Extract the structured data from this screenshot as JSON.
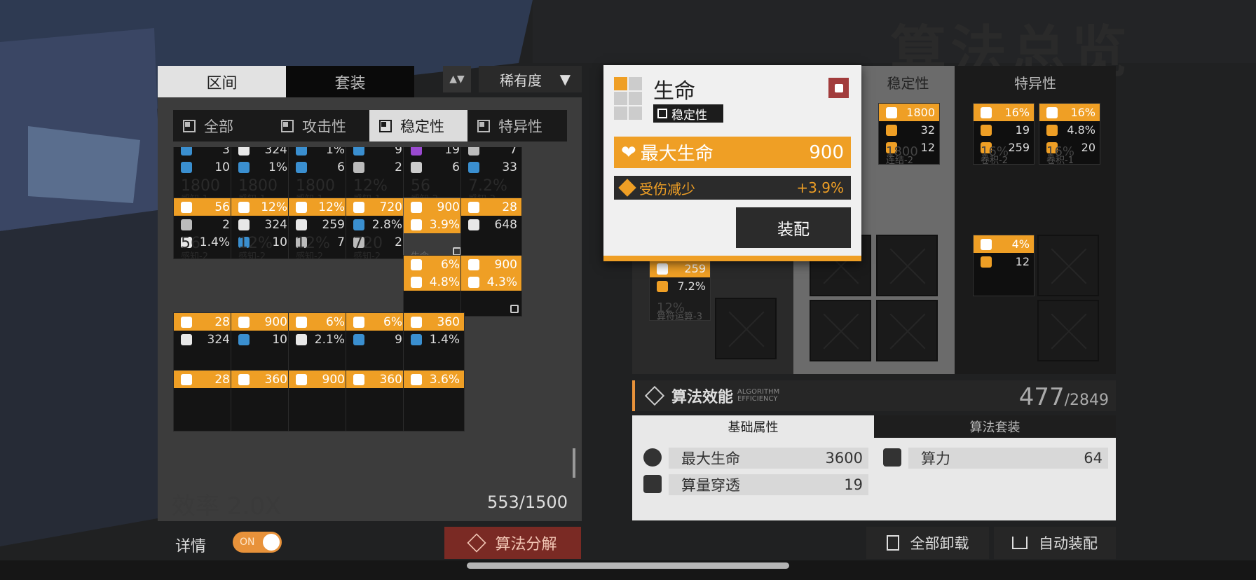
{
  "header": {
    "watermark": "算法总览"
  },
  "left": {
    "tabs": [
      {
        "label": "区间",
        "active": true
      },
      {
        "label": "套装",
        "active": false
      }
    ],
    "sort_label": "稀有度",
    "filters": [
      {
        "label": "全部",
        "icon": "grid-icon",
        "active": false
      },
      {
        "label": "攻击性",
        "icon": "attack-icon",
        "active": false
      },
      {
        "label": "稳定性",
        "icon": "stability-icon",
        "active": true
      },
      {
        "label": "特异性",
        "icon": "special-icon",
        "active": false
      }
    ],
    "cards": [
      {
        "r": 0,
        "c": 0,
        "rows": [
          {
            "style": "dk",
            "icon": "shield-icon",
            "value": "3"
          },
          {
            "style": "dk",
            "icon": "shield-icon",
            "value": "10"
          }
        ],
        "ghost": "1800",
        "ghost_label": "感知-1"
      },
      {
        "r": 0,
        "c": 1,
        "rows": [
          {
            "style": "dk",
            "icon": "heart-icon",
            "value": "324"
          },
          {
            "style": "dk",
            "icon": "shield-icon",
            "value": "1%"
          }
        ],
        "ghost": "1800",
        "ghost_label": "感知-1"
      },
      {
        "r": 0,
        "c": 2,
        "rows": [
          {
            "style": "dk",
            "icon": "shield-icon",
            "value": "1%"
          },
          {
            "style": "dk",
            "icon": "shield-icon",
            "value": "6"
          }
        ],
        "ghost": "1800",
        "ghost_label": "感知-1"
      },
      {
        "r": 0,
        "c": 3,
        "rows": [
          {
            "style": "dk",
            "icon": "power-icon",
            "value": "9"
          },
          {
            "style": "dk",
            "icon": "pierce-icon",
            "value": "2"
          }
        ],
        "ghost": "12%",
        "ghost_label": "感知-1"
      },
      {
        "r": 0,
        "c": 4,
        "rows": [
          {
            "style": "dk",
            "icon": "crown-icon",
            "value": "19"
          },
          {
            "style": "dk",
            "icon": "arrow-icon",
            "value": "6"
          }
        ],
        "ghost": "56",
        "ghost_label": "感知-2"
      },
      {
        "r": 0,
        "c": 5,
        "rows": [
          {
            "style": "dk",
            "icon": "pierce-icon",
            "value": "7"
          },
          {
            "style": "dk",
            "icon": "shield-icon",
            "value": "33"
          }
        ],
        "ghost": "7.2%",
        "ghost_label": "感知-2"
      },
      {
        "r": 1,
        "c": 0,
        "rows": [
          {
            "style": "or",
            "icon": "shield-icon",
            "value": "56"
          },
          {
            "style": "dk",
            "icon": "pierce-icon",
            "value": "2"
          },
          {
            "style": "dk",
            "icon": "heart-icon",
            "value": "1.4%"
          }
        ],
        "ghost": "56",
        "ghost_label": "感知-2"
      },
      {
        "r": 1,
        "c": 1,
        "rows": [
          {
            "style": "or",
            "icon": "heart-icon",
            "value": "12%"
          },
          {
            "style": "dk",
            "icon": "heart-icon",
            "value": "324"
          },
          {
            "style": "dk",
            "icon": "shield-icon",
            "value": "10"
          }
        ],
        "ghost": "12%",
        "ghost_label": "感知-2"
      },
      {
        "r": 1,
        "c": 2,
        "rows": [
          {
            "style": "or",
            "icon": "heart-icon",
            "value": "12%"
          },
          {
            "style": "dk",
            "icon": "heart-icon",
            "value": "259"
          },
          {
            "style": "dk",
            "icon": "pierce-icon",
            "value": "7"
          }
        ],
        "ghost": "12%",
        "ghost_label": "感知-2"
      },
      {
        "r": 1,
        "c": 3,
        "rows": [
          {
            "style": "or",
            "icon": "heart-icon",
            "value": "720"
          },
          {
            "style": "dk",
            "icon": "gear-icon",
            "value": "2.8%"
          },
          {
            "style": "dk",
            "icon": "pierce-icon",
            "value": "2"
          }
        ],
        "ghost": "720",
        "ghost_label": "感知-2"
      },
      {
        "r": 1,
        "c": 4,
        "selected": true,
        "locked": true,
        "rows": [
          {
            "style": "or",
            "icon": "heart-icon",
            "value": "900"
          },
          {
            "style": "or",
            "icon": "bandage-icon",
            "value": "3.9%"
          }
        ],
        "ghost": "",
        "ghost_label": "生命"
      },
      {
        "r": 1,
        "c": 5,
        "rows": [
          {
            "style": "or",
            "icon": "shield-icon",
            "value": "28"
          },
          {
            "style": "dk",
            "icon": "heart-icon",
            "value": "648"
          }
        ],
        "ghost": "",
        "ghost_label": ""
      },
      {
        "r": 2,
        "c": 4,
        "rows": [
          {
            "style": "or",
            "icon": "heart-icon",
            "value": "6%"
          },
          {
            "style": "or",
            "icon": "gear-icon",
            "value": "4.8%"
          }
        ],
        "ghost": "",
        "ghost_label": ""
      },
      {
        "r": 2,
        "c": 5,
        "locked": true,
        "rows": [
          {
            "style": "or",
            "icon": "heart-icon",
            "value": "900"
          },
          {
            "style": "or",
            "icon": "heart-icon",
            "value": "4.3%"
          }
        ],
        "ghost": "",
        "ghost_label": ""
      },
      {
        "r": 3,
        "c": 0,
        "rows": [
          {
            "style": "or",
            "icon": "shield-icon",
            "value": "28"
          },
          {
            "style": "dk",
            "icon": "heart-icon",
            "value": "324"
          }
        ],
        "ghost": "",
        "ghost_label": ""
      },
      {
        "r": 3,
        "c": 1,
        "rows": [
          {
            "style": "or",
            "icon": "heart-icon",
            "value": "900"
          },
          {
            "style": "dk",
            "icon": "shield-icon",
            "value": "10"
          }
        ],
        "ghost": "",
        "ghost_label": ""
      },
      {
        "r": 3,
        "c": 2,
        "rows": [
          {
            "style": "or",
            "icon": "heart-icon",
            "value": "6%"
          },
          {
            "style": "dk",
            "icon": "heart-icon",
            "value": "2.1%"
          }
        ],
        "ghost": "",
        "ghost_label": ""
      },
      {
        "r": 3,
        "c": 3,
        "rows": [
          {
            "style": "or",
            "icon": "heart-icon",
            "value": "6%"
          },
          {
            "style": "dk",
            "icon": "power-icon",
            "value": "9"
          }
        ],
        "ghost": "",
        "ghost_label": ""
      },
      {
        "r": 3,
        "c": 4,
        "rows": [
          {
            "style": "or",
            "icon": "heart-icon",
            "value": "360"
          },
          {
            "style": "dk",
            "icon": "gear-icon",
            "value": "1.4%"
          }
        ],
        "ghost": "",
        "ghost_label": ""
      },
      {
        "r": 4,
        "c": 0,
        "rows": [
          {
            "style": "or",
            "icon": "shield-icon",
            "value": "28"
          }
        ],
        "ghost": "",
        "ghost_label": ""
      },
      {
        "r": 4,
        "c": 1,
        "rows": [
          {
            "style": "or",
            "icon": "heart-icon",
            "value": "360"
          }
        ],
        "ghost": "",
        "ghost_label": ""
      },
      {
        "r": 4,
        "c": 2,
        "rows": [
          {
            "style": "or",
            "icon": "heart-icon",
            "value": "900"
          }
        ],
        "ghost": "",
        "ghost_label": ""
      },
      {
        "r": 4,
        "c": 3,
        "rows": [
          {
            "style": "or",
            "icon": "heart-icon",
            "value": "360"
          }
        ],
        "ghost": "",
        "ghost_label": ""
      },
      {
        "r": 4,
        "c": 4,
        "rows": [
          {
            "style": "or",
            "icon": "shield-icon",
            "value": "3.6%"
          }
        ],
        "ghost": "",
        "ghost_label": ""
      }
    ],
    "background_text": "效率 2.0X",
    "counter": "553/1500",
    "detail_label": "详情",
    "toggle_label": "ON",
    "decompose_label": "算法分解"
  },
  "right": {
    "col_tabs": [
      {
        "label": "稳定性"
      },
      {
        "label": "特异性"
      }
    ],
    "stable_cards": [
      {
        "rows": [
          {
            "value": "1800"
          },
          {
            "value": "32"
          },
          {
            "value": "12"
          }
        ],
        "ghost": "1800",
        "label": "连结-2"
      }
    ],
    "special_cards": [
      {
        "rows": [
          {
            "value": "16%"
          },
          {
            "value": "19"
          },
          {
            "value": "259"
          }
        ],
        "ghost": "16%",
        "label": "卷积-2"
      },
      {
        "rows": [
          {
            "value": "16%"
          },
          {
            "value": "4.8%"
          },
          {
            "value": "20"
          }
        ],
        "ghost": "16%",
        "label": "卷积-1"
      },
      {
        "rows": [
          {
            "value": "4%"
          },
          {
            "value": "12"
          }
        ],
        "ghost": "",
        "label": ""
      }
    ],
    "left_card": {
      "rows": [
        {
          "value": "259"
        },
        {
          "value": "7.2%"
        }
      ],
      "ghost": "12%",
      "label": "算符运算-3"
    },
    "efficiency": {
      "title": "算法效能",
      "sub": "ALGORITHM EFFICIENCY",
      "current": "477",
      "total": "/2849"
    },
    "prop_tabs": [
      {
        "label": "基础属性",
        "active": true
      },
      {
        "label": "算法套装",
        "active": false
      }
    ],
    "stats": [
      {
        "icon": "heart-icon",
        "label": "最大生命",
        "value": "3600"
      },
      {
        "icon": "power-icon",
        "label": "算力",
        "value": "64"
      },
      {
        "icon": "pierce-icon",
        "label": "算量穿透",
        "value": "19"
      }
    ],
    "unload_all": "全部卸载",
    "auto_equip": "自动装配"
  },
  "popup": {
    "name": "生命",
    "tag": "稳定性",
    "main_stat": {
      "label": "最大生命",
      "value": "900"
    },
    "sub_stat": {
      "label": "受伤减少",
      "value": "+3.9%"
    },
    "equip_label": "装配"
  },
  "colors": {
    "accent": "#ef9f25",
    "lock_red": "#a23c3c",
    "panel_dark": "#141414"
  }
}
